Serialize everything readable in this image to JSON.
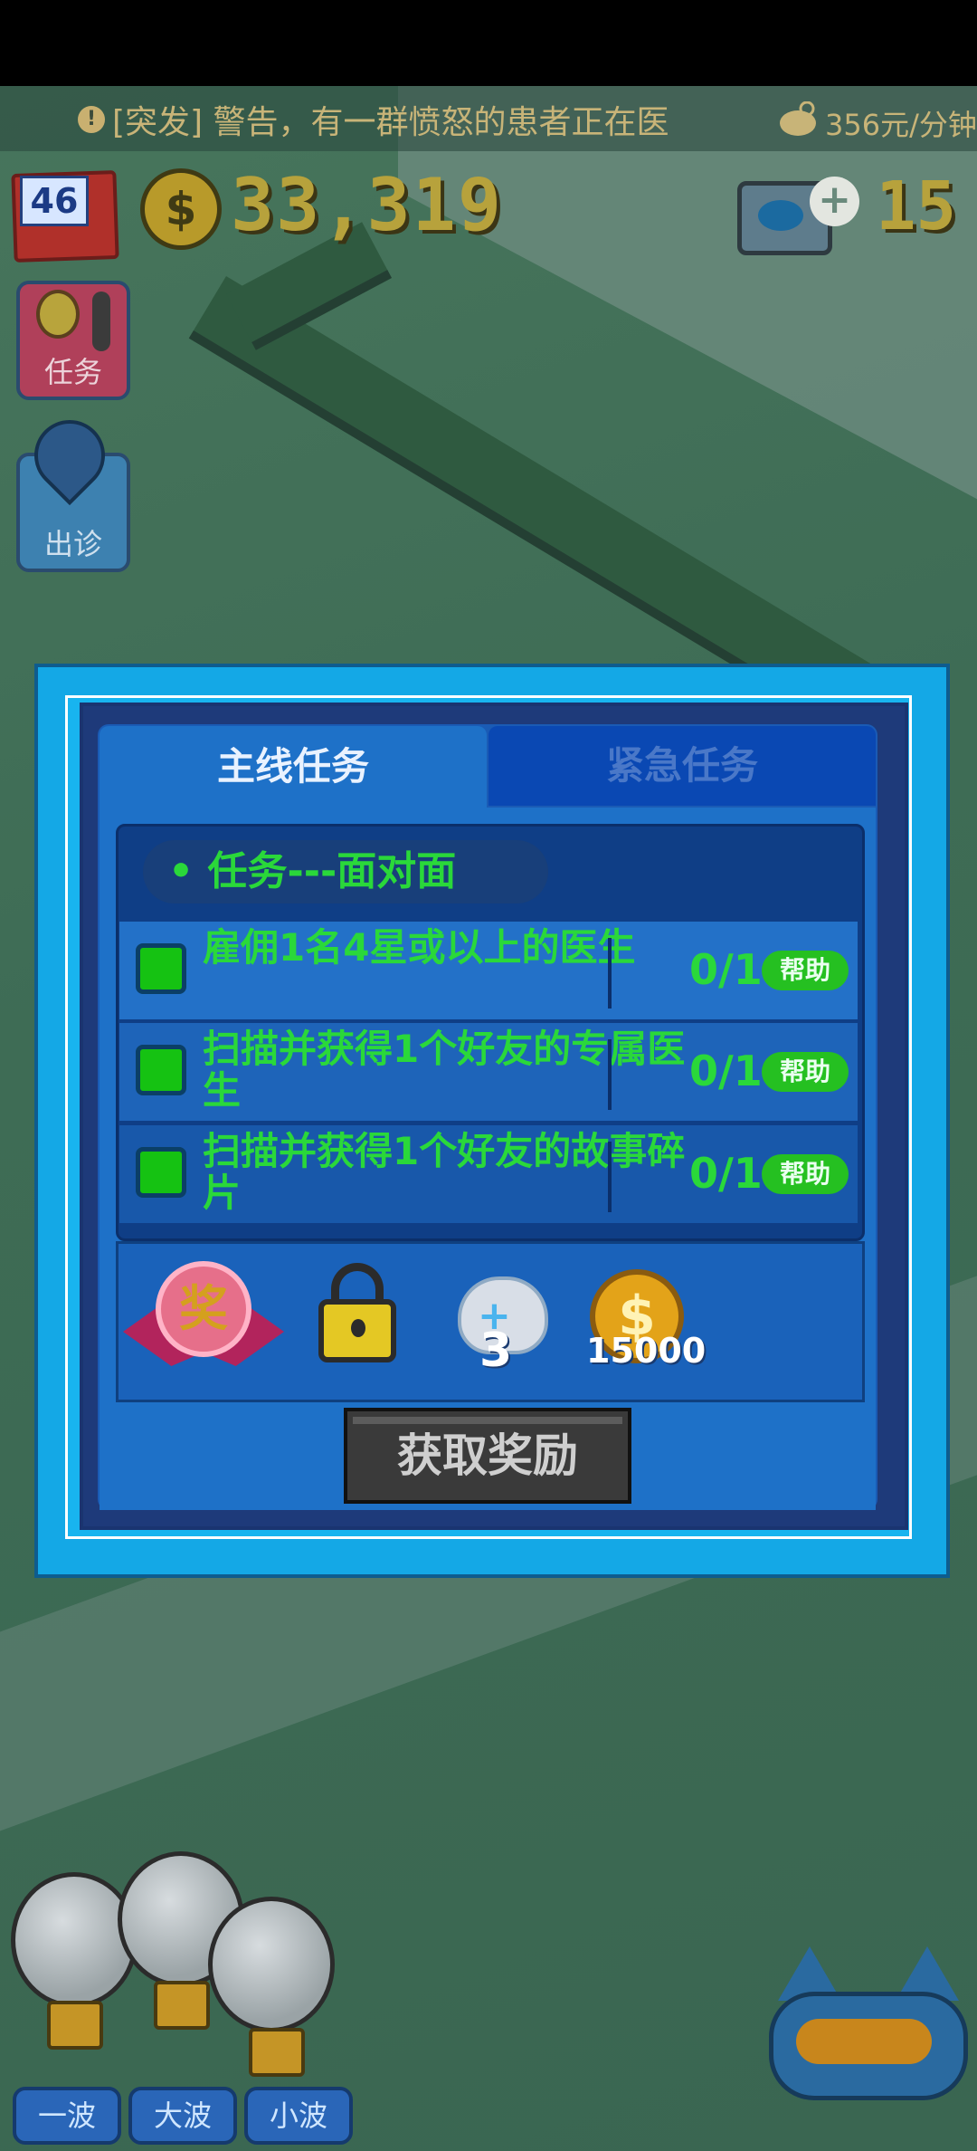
{
  "notification": {
    "prefix": "[突发]",
    "message": "警告，有一群愤怒的患者正在医",
    "income": "356元/分钟"
  },
  "status": {
    "level": "46",
    "coins": "33,319",
    "gems": "15"
  },
  "side_buttons": {
    "tasks_label": "任务",
    "clinic_label": "出诊"
  },
  "wave_buttons": [
    "一波",
    "大波",
    "小波"
  ],
  "dialog": {
    "tabs": {
      "main": "主线任务",
      "urgent": "紧急任务"
    },
    "task_title": "• 任务---面对面",
    "tasks": [
      {
        "text": "雇佣1名4星或以上的医生",
        "progress": "0/1",
        "help": "帮助"
      },
      {
        "text": "扫描并获得1个好友的专属医生",
        "progress": "0/1",
        "help": "帮助"
      },
      {
        "text": "扫描并获得1个好友的故事碎片",
        "progress": "0/1",
        "help": "帮助"
      }
    ],
    "rewards": {
      "medal_char": "奖",
      "cat_count": "3",
      "gold_amount": "15000"
    },
    "claim_button": "获取奖励"
  }
}
